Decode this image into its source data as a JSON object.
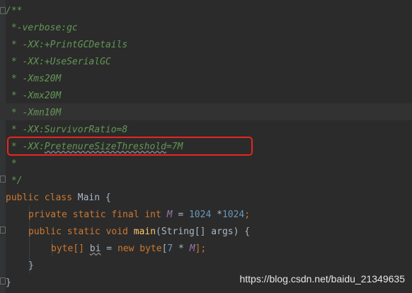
{
  "editor": {
    "language": "Java",
    "highlight_color": "#e8261e"
  },
  "code": {
    "l1": "/**",
    "l2": " *-verbose:gc",
    "l3a": " * -XX:",
    "l3b": "+PrintGCDetails",
    "l4a": " * -XX:",
    "l4b": "+UseSerialGC",
    "l5": " * -Xms20M",
    "l6": " * -Xmx20M",
    "l7": " * -Xmn10M",
    "l8": " * -XX:SurvivorRatio=8",
    "l9a": " * -XX:",
    "l9b": "PretenureSizeThreshold",
    "l9c": "=7M",
    "l10": " *",
    "l11": " */",
    "l12": {
      "kw1": "public",
      "kw2": "class",
      "name": "Main",
      "brace": "{"
    },
    "l13": {
      "mods": "private static final int",
      "field": "M",
      "eq": "=",
      "n1": "1024",
      "op": "*",
      "n2": "1024",
      "semi": ";"
    },
    "l14": {
      "mods": "public static void",
      "method": "main",
      "params": "(String[] args) {"
    },
    "l15": {
      "type": "byte[]",
      "var": "bi",
      "eq": "=",
      "kw_new": "new",
      "kw_byte": "byte",
      "open": "[",
      "num": "7",
      "op": "*",
      "field": "M",
      "close": "];"
    },
    "l16": "}",
    "l17": "}"
  },
  "watermark": "https://blog.csdn.net/baidu_21349635"
}
